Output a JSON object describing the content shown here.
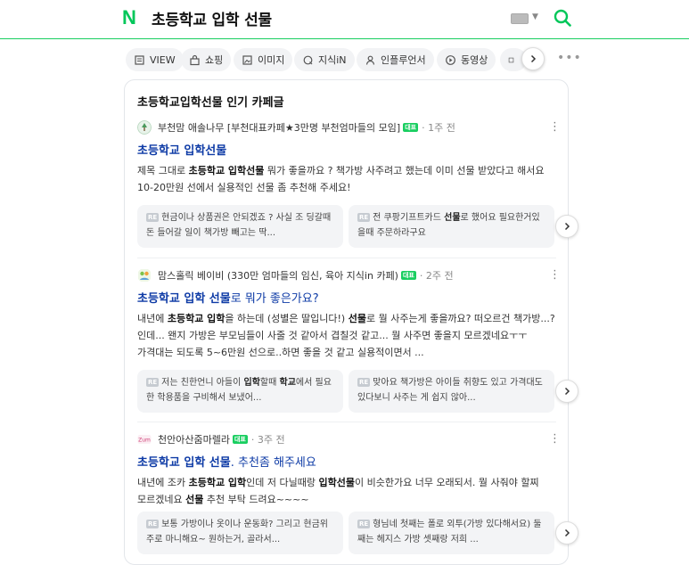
{
  "header": {
    "logo": "N",
    "query": "초등학교 입학 선물",
    "search_icon": "search-icon",
    "keyboard_icon": "keyboard-icon"
  },
  "tabs": [
    {
      "label": "VIEW",
      "icon": "doc-icon"
    },
    {
      "label": "쇼핑",
      "icon": "bag-icon"
    },
    {
      "label": "이미지",
      "icon": "image-icon"
    },
    {
      "label": "지식iN",
      "icon": "qna-icon"
    },
    {
      "label": "인플루언서",
      "icon": "person-icon"
    },
    {
      "label": "동영상",
      "icon": "play-icon"
    }
  ],
  "section_title": "초등학교입학선물 인기 카페글",
  "items": [
    {
      "source": "부천맘 애솔나무 [부천대표카페★3만명 부천엄마들의 모임]",
      "badge": "대표",
      "time": "1주 전",
      "title_bold": "초등학교 입학선물",
      "title_rest": "",
      "desc_parts": [
        "제목 그대로 ",
        "초등학교 입학선물",
        " 뭐가 좋을까요 ? 책가방 사주려고 했는데 이미 선물 받았다고 해서요 10-20만원 선에서 실용적인 선물 좀 추천해 주세요!"
      ],
      "replies": [
        {
          "re": "RE",
          "text": "현금이나 상품권은 안되겠죠 ? 사실 조 딩갈때 돈 들어갈 일이 책가방 빼고는 딱..."
        },
        {
          "re": "RE",
          "pre": "전 쿠팡기프트카드 ",
          "bold": "선물",
          "post": "로 했어요 필요한거있을때 주문하라구요"
        }
      ]
    },
    {
      "source": "맘스홀릭 베이비 (330만 엄마들의 임신, 육아 지식in 카페)",
      "badge": "대표",
      "time": "2주 전",
      "title_bold": "초등학교 입학 선물",
      "title_rest": "로 뭐가 좋은가요?",
      "desc_parts": [
        "내년에 ",
        "초등학교 입학",
        "을 하는데 (성별은 딸입니다!) ",
        "선물",
        "로 뭘 사주는게 좋을까요? 떠오르건 책가방...? 인데... 왠지 가방은 부모님들이 사줄 것 같아서 겹칠것 같고... 뭘 사주면 좋을지 모르겠네요ㅜㅜ 가격대는 되도록 5~6만원 선으로..하면 좋을 것 같고 실용적이면서 ..."
      ],
      "replies": [
        {
          "re": "RE",
          "pre": "저는 친한언니 아들이 ",
          "bold": "입학",
          "mid": "할때 ",
          "bold2": "학교",
          "post": "에서 필요한 학용품을 구비해서 보냈어..."
        },
        {
          "re": "RE",
          "text": "맞아요 책가방은 아이들 취향도 있고 가격대도 있다보니 사주는 게 쉽지 않아..."
        }
      ]
    },
    {
      "source": "천안아산줌마렐라",
      "badge": "대표",
      "time": "3주 전",
      "title_bold": "초등학교 입학 선물",
      "title_rest": ". 추천좀 해주세요",
      "desc_parts": [
        "내년에 조카 ",
        "초등학교 입학",
        "인데 저 다닐때랑 ",
        "입학선물",
        "이 비슷한가요 너무 오래되서. 뭘 사줘야 할찌 모르겠네요 ",
        "선물",
        " 추천 부탁 드려요~~~~"
      ],
      "replies": [
        {
          "re": "RE",
          "text": "보통 가방이나 옷이나 운동화? 그리고 현금위주로 마니해요~ 원하는거, 골라서..."
        },
        {
          "re": "RE",
          "text": "형님네 첫째는 폴로 외투(가방 있다해서요) 둘째는 헤지스 가방 셋째랑 저희 ..."
        }
      ]
    }
  ],
  "colors": {
    "accent": "#03c75a",
    "title_link": "#0e3ba6"
  }
}
